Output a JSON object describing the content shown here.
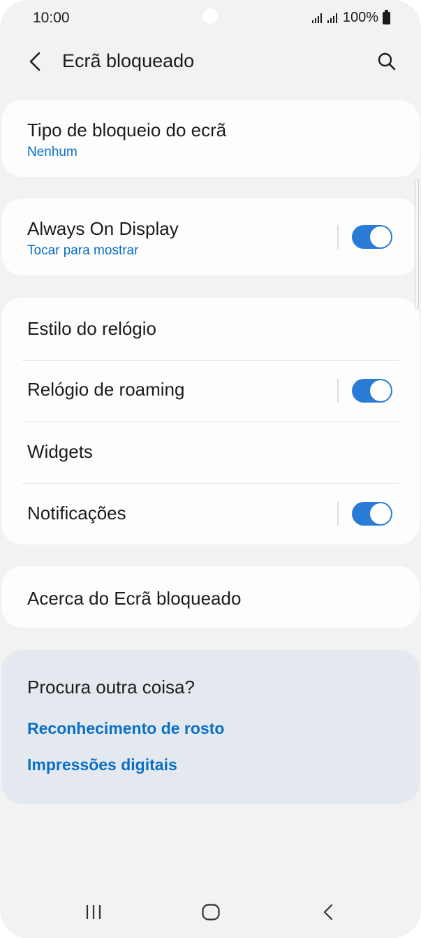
{
  "status_bar": {
    "time": "10:00",
    "battery": "100%",
    "signal_icon": "signal-icon",
    "battery_icon": "battery-icon"
  },
  "header": {
    "title": "Ecrã bloqueado",
    "back_icon": "back-arrow-icon",
    "search_icon": "search-icon"
  },
  "lock_type": {
    "title": "Tipo de bloqueio do ecrã",
    "value": "Nenhum"
  },
  "always_on": {
    "title": "Always On Display",
    "subtitle": "Tocar para mostrar",
    "enabled": true
  },
  "settings": {
    "clock_style": "Estilo do relógio",
    "roaming_clock": "Relógio de roaming",
    "roaming_enabled": true,
    "widgets": "Widgets",
    "notifications": "Notificações",
    "notifications_enabled": true
  },
  "about": {
    "title": "Acerca do Ecrã bloqueado"
  },
  "suggestions": {
    "title": "Procura outra coisa?",
    "links": [
      "Reconhecimento de rosto",
      "Impressões digitais"
    ]
  },
  "colors": {
    "accent": "#0a6fc7",
    "toggle_on": "#2a7bd6",
    "background": "#f2f2f2",
    "card": "#fdfdfd",
    "suggest_card": "#e4e9ef"
  },
  "navbar": {
    "recents_icon": "recents-icon",
    "home_icon": "home-icon",
    "back_icon": "nav-back-icon"
  }
}
